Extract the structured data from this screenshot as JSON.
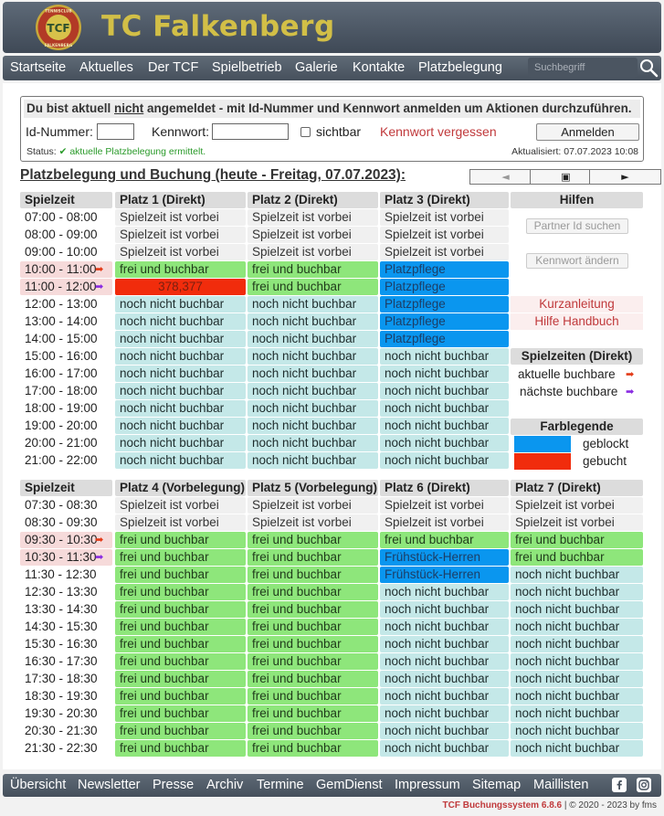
{
  "site": {
    "title": "TC Falkenberg",
    "logo_text": "TCF",
    "logo_ring_top": "TENNISCLUB",
    "logo_ring_bottom": "FALKENBERG"
  },
  "nav": {
    "items": [
      "Startseite",
      "Aktuelles",
      "Der TCF",
      "Spielbetrieb",
      "Galerie",
      "Kontakte",
      "Platzbelegung"
    ],
    "search_placeholder": "Suchbegriff"
  },
  "login": {
    "msg_pre": "Du bist aktuell ",
    "msg_not": "nicht",
    "msg_post": " angemeldet - mit Id-Nummer und Kennwort anmelden um Aktionen durchzuführen.",
    "id_label": "Id-Nummer:",
    "pw_label": "Kennwort:",
    "visible_label": "sichtbar",
    "forgot": "Kennwort vergessen",
    "button": "Anmelden",
    "status_label": "Status:",
    "status_text": "✔ aktuelle Platzbelegung ermittelt.",
    "updated": "Aktualisiert: 07.07.2023 10:08"
  },
  "heading": "Platzbelegung und Buchung (heute - Freitag, 07.07.2023):",
  "nav_arrows": [
    "◄",
    "▣",
    "►"
  ],
  "grid1": {
    "headers": [
      "Spielzeit",
      "Platz 1 (Direkt)",
      "Platz 2 (Direkt)",
      "Platz 3 (Direkt)"
    ],
    "rows": [
      {
        "time": "07:00 - 08:00",
        "cells": [
          [
            "past",
            "Spielzeit ist vorbei"
          ],
          [
            "past",
            "Spielzeit ist vorbei"
          ],
          [
            "past",
            "Spielzeit ist vorbei"
          ]
        ]
      },
      {
        "time": "08:00 - 09:00",
        "cells": [
          [
            "past",
            "Spielzeit ist vorbei"
          ],
          [
            "past",
            "Spielzeit ist vorbei"
          ],
          [
            "past",
            "Spielzeit ist vorbei"
          ]
        ]
      },
      {
        "time": "09:00 - 10:00",
        "cells": [
          [
            "past",
            "Spielzeit ist vorbei"
          ],
          [
            "past",
            "Spielzeit ist vorbei"
          ],
          [
            "past",
            "Spielzeit ist vorbei"
          ]
        ]
      },
      {
        "time": "10:00 - 11:00",
        "marker": "red",
        "cells": [
          [
            "free",
            "frei und buchbar"
          ],
          [
            "free",
            "frei und buchbar"
          ],
          [
            "blocked",
            "Platzpflege"
          ]
        ]
      },
      {
        "time": "11:00 - 12:00",
        "marker": "purple",
        "cells": [
          [
            "booked",
            "378,377"
          ],
          [
            "free",
            "frei und buchbar"
          ],
          [
            "blocked",
            "Platzpflege"
          ]
        ]
      },
      {
        "time": "12:00 - 13:00",
        "cells": [
          [
            "notyet",
            "noch nicht buchbar"
          ],
          [
            "notyet",
            "noch nicht buchbar"
          ],
          [
            "blocked",
            "Platzpflege"
          ]
        ]
      },
      {
        "time": "13:00 - 14:00",
        "cells": [
          [
            "notyet",
            "noch nicht buchbar"
          ],
          [
            "notyet",
            "noch nicht buchbar"
          ],
          [
            "blocked",
            "Platzpflege"
          ]
        ]
      },
      {
        "time": "14:00 - 15:00",
        "cells": [
          [
            "notyet",
            "noch nicht buchbar"
          ],
          [
            "notyet",
            "noch nicht buchbar"
          ],
          [
            "blocked",
            "Platzpflege"
          ]
        ]
      },
      {
        "time": "15:00 - 16:00",
        "cells": [
          [
            "notyet",
            "noch nicht buchbar"
          ],
          [
            "notyet",
            "noch nicht buchbar"
          ],
          [
            "notyet",
            "noch nicht buchbar"
          ]
        ]
      },
      {
        "time": "16:00 - 17:00",
        "cells": [
          [
            "notyet",
            "noch nicht buchbar"
          ],
          [
            "notyet",
            "noch nicht buchbar"
          ],
          [
            "notyet",
            "noch nicht buchbar"
          ]
        ]
      },
      {
        "time": "17:00 - 18:00",
        "cells": [
          [
            "notyet",
            "noch nicht buchbar"
          ],
          [
            "notyet",
            "noch nicht buchbar"
          ],
          [
            "notyet",
            "noch nicht buchbar"
          ]
        ]
      },
      {
        "time": "18:00 - 19:00",
        "cells": [
          [
            "notyet",
            "noch nicht buchbar"
          ],
          [
            "notyet",
            "noch nicht buchbar"
          ],
          [
            "notyet",
            "noch nicht buchbar"
          ]
        ]
      },
      {
        "time": "19:00 - 20:00",
        "cells": [
          [
            "notyet",
            "noch nicht buchbar"
          ],
          [
            "notyet",
            "noch nicht buchbar"
          ],
          [
            "notyet",
            "noch nicht buchbar"
          ]
        ]
      },
      {
        "time": "20:00 - 21:00",
        "cells": [
          [
            "notyet",
            "noch nicht buchbar"
          ],
          [
            "notyet",
            "noch nicht buchbar"
          ],
          [
            "notyet",
            "noch nicht buchbar"
          ]
        ]
      },
      {
        "time": "21:00 - 22:00",
        "cells": [
          [
            "notyet",
            "noch nicht buchbar"
          ],
          [
            "notyet",
            "noch nicht buchbar"
          ],
          [
            "notyet",
            "noch nicht buchbar"
          ]
        ]
      }
    ]
  },
  "help": {
    "title": "Hilfen",
    "partner_btn": "Partner Id suchen",
    "pw_btn": "Kennwort ändern",
    "short_guide": "Kurzanleitung",
    "manual": "Hilfe Handbuch",
    "times_title": "Spielzeiten (Direkt)",
    "current": "aktuelle buchbare",
    "next": "nächste buchbare",
    "legend_title": "Farblegende",
    "legend_blocked": "geblockt",
    "legend_booked": "gebucht"
  },
  "grid2": {
    "headers": [
      "Spielzeit",
      "Platz 4 (Vorbelegung)",
      "Platz 5 (Vorbelegung)",
      "Platz 6 (Direkt)",
      "Platz 7 (Direkt)"
    ],
    "rows": [
      {
        "time": "07:30 - 08:30",
        "cells": [
          [
            "past",
            "Spielzeit ist vorbei"
          ],
          [
            "past",
            "Spielzeit ist vorbei"
          ],
          [
            "past",
            "Spielzeit ist vorbei"
          ],
          [
            "past",
            "Spielzeit ist vorbei"
          ]
        ]
      },
      {
        "time": "08:30 - 09:30",
        "cells": [
          [
            "past",
            "Spielzeit ist vorbei"
          ],
          [
            "past",
            "Spielzeit ist vorbei"
          ],
          [
            "past",
            "Spielzeit ist vorbei"
          ],
          [
            "past",
            "Spielzeit ist vorbei"
          ]
        ]
      },
      {
        "time": "09:30 - 10:30",
        "marker": "red",
        "cells": [
          [
            "free",
            "frei und buchbar"
          ],
          [
            "free",
            "frei und buchbar"
          ],
          [
            "free",
            "frei und buchbar"
          ],
          [
            "free",
            "frei und buchbar"
          ]
        ]
      },
      {
        "time": "10:30 - 11:30",
        "marker": "purple",
        "cells": [
          [
            "free",
            "frei und buchbar"
          ],
          [
            "free",
            "frei und buchbar"
          ],
          [
            "blocked",
            "Frühstück-Herren"
          ],
          [
            "free",
            "frei und buchbar"
          ]
        ]
      },
      {
        "time": "11:30 - 12:30",
        "cells": [
          [
            "free",
            "frei und buchbar"
          ],
          [
            "free",
            "frei und buchbar"
          ],
          [
            "blocked",
            "Frühstück-Herren"
          ],
          [
            "notyet",
            "noch nicht buchbar"
          ]
        ]
      },
      {
        "time": "12:30 - 13:30",
        "cells": [
          [
            "free",
            "frei und buchbar"
          ],
          [
            "free",
            "frei und buchbar"
          ],
          [
            "notyet",
            "noch nicht buchbar"
          ],
          [
            "notyet",
            "noch nicht buchbar"
          ]
        ]
      },
      {
        "time": "13:30 - 14:30",
        "cells": [
          [
            "free",
            "frei und buchbar"
          ],
          [
            "free",
            "frei und buchbar"
          ],
          [
            "notyet",
            "noch nicht buchbar"
          ],
          [
            "notyet",
            "noch nicht buchbar"
          ]
        ]
      },
      {
        "time": "14:30 - 15:30",
        "cells": [
          [
            "free",
            "frei und buchbar"
          ],
          [
            "free",
            "frei und buchbar"
          ],
          [
            "notyet",
            "noch nicht buchbar"
          ],
          [
            "notyet",
            "noch nicht buchbar"
          ]
        ]
      },
      {
        "time": "15:30 - 16:30",
        "cells": [
          [
            "free",
            "frei und buchbar"
          ],
          [
            "free",
            "frei und buchbar"
          ],
          [
            "notyet",
            "noch nicht buchbar"
          ],
          [
            "notyet",
            "noch nicht buchbar"
          ]
        ]
      },
      {
        "time": "16:30 - 17:30",
        "cells": [
          [
            "free",
            "frei und buchbar"
          ],
          [
            "free",
            "frei und buchbar"
          ],
          [
            "notyet",
            "noch nicht buchbar"
          ],
          [
            "notyet",
            "noch nicht buchbar"
          ]
        ]
      },
      {
        "time": "17:30 - 18:30",
        "cells": [
          [
            "free",
            "frei und buchbar"
          ],
          [
            "free",
            "frei und buchbar"
          ],
          [
            "notyet",
            "noch nicht buchbar"
          ],
          [
            "notyet",
            "noch nicht buchbar"
          ]
        ]
      },
      {
        "time": "18:30 - 19:30",
        "cells": [
          [
            "free",
            "frei und buchbar"
          ],
          [
            "free",
            "frei und buchbar"
          ],
          [
            "notyet",
            "noch nicht buchbar"
          ],
          [
            "notyet",
            "noch nicht buchbar"
          ]
        ]
      },
      {
        "time": "19:30 - 20:30",
        "cells": [
          [
            "free",
            "frei und buchbar"
          ],
          [
            "free",
            "frei und buchbar"
          ],
          [
            "notyet",
            "noch nicht buchbar"
          ],
          [
            "notyet",
            "noch nicht buchbar"
          ]
        ]
      },
      {
        "time": "20:30 - 21:30",
        "cells": [
          [
            "free",
            "frei und buchbar"
          ],
          [
            "free",
            "frei und buchbar"
          ],
          [
            "notyet",
            "noch nicht buchbar"
          ],
          [
            "notyet",
            "noch nicht buchbar"
          ]
        ]
      },
      {
        "time": "21:30 - 22:30",
        "cells": [
          [
            "free",
            "frei und buchbar"
          ],
          [
            "free",
            "frei und buchbar"
          ],
          [
            "notyet",
            "noch nicht buchbar"
          ],
          [
            "notyet",
            "noch nicht buchbar"
          ]
        ]
      }
    ]
  },
  "footer": {
    "items": [
      "Übersicht",
      "Newsletter",
      "Presse",
      "Archiv",
      "Termine",
      "GemDienst",
      "Impressum",
      "Sitemap",
      "Maillisten"
    ],
    "system": "TCF Buchungssystem 6.8.6",
    "copyright": " | © 2020 - 2023 by fms"
  },
  "icons": {
    "search": "search-icon",
    "facebook": "facebook-icon",
    "instagram": "instagram-icon",
    "arrow_current": "arrow-right-red-icon",
    "arrow_next": "arrow-right-purple-icon"
  },
  "colors": {
    "free": "#8ee67b",
    "not_yet": "#c4e8e8",
    "blocked": "#0a96ef",
    "booked": "#f12c0c",
    "past": "#f0f0f0",
    "accent_red": "#c0393b",
    "title_gold": "#d2bf47"
  }
}
